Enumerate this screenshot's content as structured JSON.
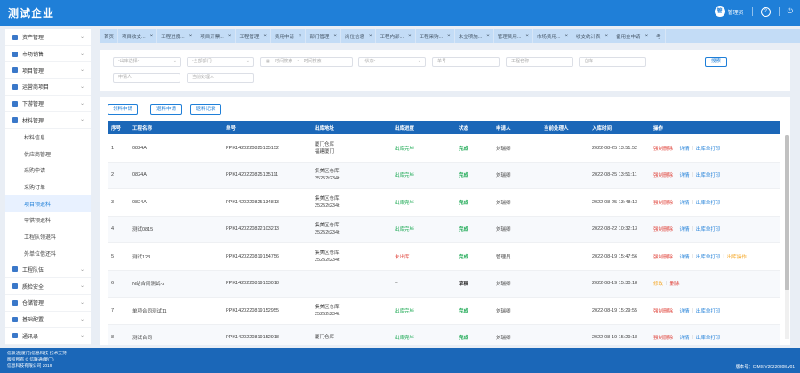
{
  "header": {
    "logo": "测试企业",
    "avatar_text": "管",
    "user": "管理员",
    "help_icon": "?",
    "logout_icon": "⏻"
  },
  "sidebar": {
    "groups_top": [
      {
        "label": "资产管理",
        "icon": "box-icon"
      },
      {
        "label": "市场销售",
        "icon": "cart-icon"
      },
      {
        "label": "项目管理",
        "icon": "project-icon"
      },
      {
        "label": "运营商项目",
        "icon": "cube-icon"
      },
      {
        "label": "下游管理",
        "icon": "folder-icon"
      },
      {
        "label": "材料管理",
        "icon": "grid-icon"
      }
    ],
    "sub_items": [
      "材料信息",
      "供应商管理",
      "采购申请",
      "采购订单",
      "项目领退料",
      "甲供领退料",
      "工程队领退料",
      "外单位借还料"
    ],
    "active_sub": "项目领退料",
    "groups_bottom": [
      {
        "label": "工程队伍",
        "icon": "team-icon"
      },
      {
        "label": "质检安全",
        "icon": "shield-icon"
      },
      {
        "label": "仓储管理",
        "icon": "warehouse-icon"
      },
      {
        "label": "基础配置",
        "icon": "config-icon"
      },
      {
        "label": "通讯录",
        "icon": "contacts-icon"
      }
    ]
  },
  "tabs": [
    "首页",
    "项目收支...",
    "工程进度...",
    "项目开票...",
    "工程管理",
    "费用申请",
    "部门管理",
    "岗位信息",
    "工程内部...",
    "工程采购...",
    "未立项施...",
    "管理费用...",
    "市场费用...",
    "收支统计表",
    "备用金申请",
    "考"
  ],
  "filters": {
    "project": "-出库选择-",
    "company": "-全部部门-",
    "date_start": "时间搜索",
    "date_sep": "-",
    "date_end": "时间搜索",
    "status": "-状态-",
    "order_no": "单号",
    "project_name": "工程名称",
    "warehouse": "仓库",
    "applicant": "申请人",
    "handler": "当前处理人",
    "search_button": "搜索"
  },
  "actions": {
    "pick": "领料申请",
    "return": "退料申请",
    "record": "退料记录"
  },
  "table": {
    "columns": [
      "序号",
      "工程名称",
      "单号",
      "出库地址",
      "出库进度",
      "状态",
      "申请人",
      "当前处理人",
      "入库时间",
      "操作"
    ],
    "rows": [
      {
        "no": "1",
        "name": "0824A",
        "order": "PPK1420220825135152",
        "addr1": "厦门仓库",
        "addr2": "福建厦门",
        "progress": "出库完毕",
        "progress_color": "#1faa55",
        "status": "完成",
        "status_color": "#1faa55",
        "applicant": "刘瑞卿",
        "handler": "",
        "time": "2022-08-25 13:51:52",
        "op": [
          "强制删除",
          "详情",
          "出库单打印"
        ]
      },
      {
        "no": "2",
        "name": "0824A",
        "order": "PPK1420220825135111",
        "addr1": "集美区仓库",
        "addr2": "25252t234t",
        "progress": "出库完毕",
        "progress_color": "#1faa55",
        "status": "完成",
        "status_color": "#1faa55",
        "applicant": "刘瑞卿",
        "handler": "",
        "time": "2022-08-25 13:51:11",
        "op": [
          "强制删除",
          "详情",
          "出库单打印"
        ]
      },
      {
        "no": "3",
        "name": "0824A",
        "order": "PPK1420220825134813",
        "addr1": "集美区仓库",
        "addr2": "25252t234t",
        "progress": "出库完毕",
        "progress_color": "#1faa55",
        "status": "完成",
        "status_color": "#1faa55",
        "applicant": "刘瑞卿",
        "handler": "",
        "time": "2022-08-25 13:48:13",
        "op": [
          "强制删除",
          "详情",
          "出库单打印"
        ]
      },
      {
        "no": "4",
        "name": "测试0815",
        "order": "PPK1420220822103213",
        "addr1": "集美区仓库",
        "addr2": "25252t234t",
        "progress": "出库完毕",
        "progress_color": "#1faa55",
        "status": "完成",
        "status_color": "#1faa55",
        "applicant": "刘瑞卿",
        "handler": "",
        "time": "2022-08-22 10:32:13",
        "op": [
          "强制删除",
          "详情",
          "出库单打印"
        ]
      },
      {
        "no": "5",
        "name": "测试123",
        "order": "PPK1420220819154756",
        "addr1": "集美区仓库",
        "addr2": "25252t234t",
        "progress": "未出库",
        "progress_color": "#e0443b",
        "status": "完成",
        "status_color": "#1faa55",
        "applicant": "管理员",
        "handler": "",
        "time": "2022-08-19 15:47:56",
        "op": [
          "强制删除",
          "详情",
          "出库单打印",
          "出库操作"
        ]
      },
      {
        "no": "6",
        "name": "N站合同测试-2",
        "order": "PPK1420220819153018",
        "addr1": "",
        "addr2": "",
        "progress": "--",
        "progress_color": "#444444",
        "status": "草稿",
        "status_color": "#333333",
        "applicant": "刘瑞卿",
        "handler": "",
        "time": "2022-08-19 15:30:18",
        "op": [
          "修改",
          "删除"
        ]
      },
      {
        "no": "7",
        "name": "单项合同测试11",
        "order": "PPK1420220819152955",
        "addr1": "集美区仓库",
        "addr2": "25252t234t",
        "progress": "出库完毕",
        "progress_color": "#1faa55",
        "status": "完成",
        "status_color": "#1faa55",
        "applicant": "刘瑞卿",
        "handler": "",
        "time": "2022-08-19 15:29:55",
        "op": [
          "强制删除",
          "详情",
          "出库单打印"
        ]
      },
      {
        "no": "8",
        "name": "测试合同",
        "order": "PPK1420220819152918",
        "addr1": "厦门仓库",
        "addr2": "",
        "progress": "出库完毕",
        "progress_color": "#1faa55",
        "status": "完成",
        "status_color": "#1faa55",
        "applicant": "刘瑞卿",
        "handler": "",
        "time": "2022-08-19 15:29:18",
        "op": [
          "强制删除",
          "详情",
          "出库单打印"
        ]
      }
    ]
  },
  "footer": {
    "line1": "信联通(厦门)信息科技 技术支持",
    "line2": "版权所有 © 信联通(厦门)",
    "line3": "信息科技有限公司 2019",
    "version": "版本号：CIMS-V20220808.v01"
  }
}
